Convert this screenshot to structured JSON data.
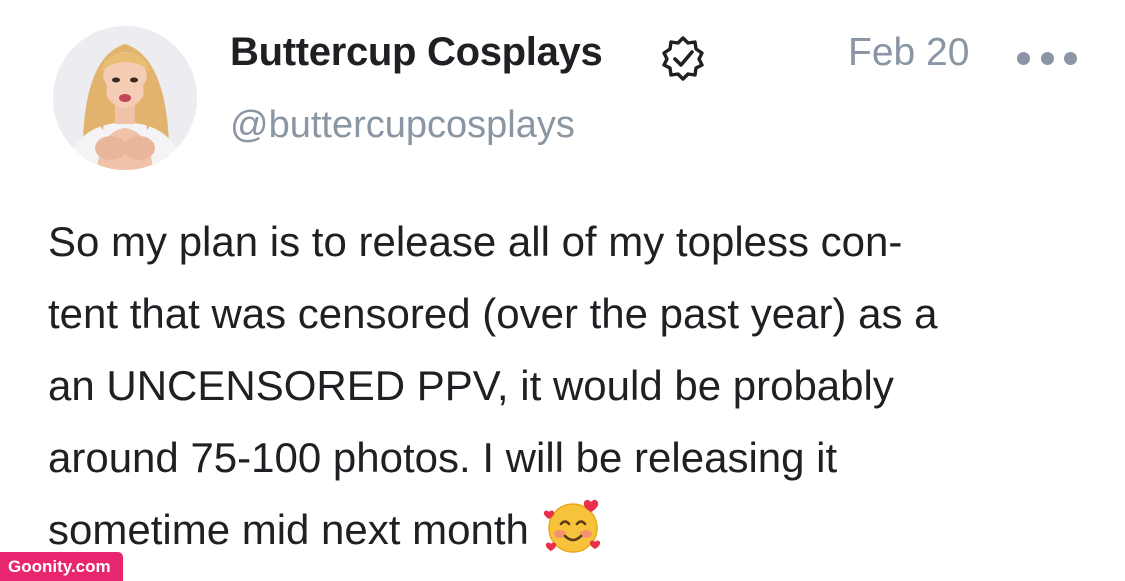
{
  "post": {
    "author": {
      "display_name": "Buttercup Cosplays",
      "handle": "@buttercupcosplays",
      "verified": true,
      "avatar_icon": "profile-photo"
    },
    "date": "Feb 20",
    "more_icon": "more-dots-icon",
    "body_lines": [
      "So my plan is to release all of my topless con-",
      "tent that was censored (over the past year) as a",
      "an UNCENSORED PPV, it would be probably",
      "around 75-100 photos. I will be releasing it",
      "sometime mid next month"
    ],
    "body_emoji": "smiling-face-with-hearts"
  },
  "watermark": "Goonity.com",
  "colors": {
    "text_primary": "#1f1f24",
    "text_secondary": "#8a96a3",
    "watermark_bg": "#e8266f"
  }
}
